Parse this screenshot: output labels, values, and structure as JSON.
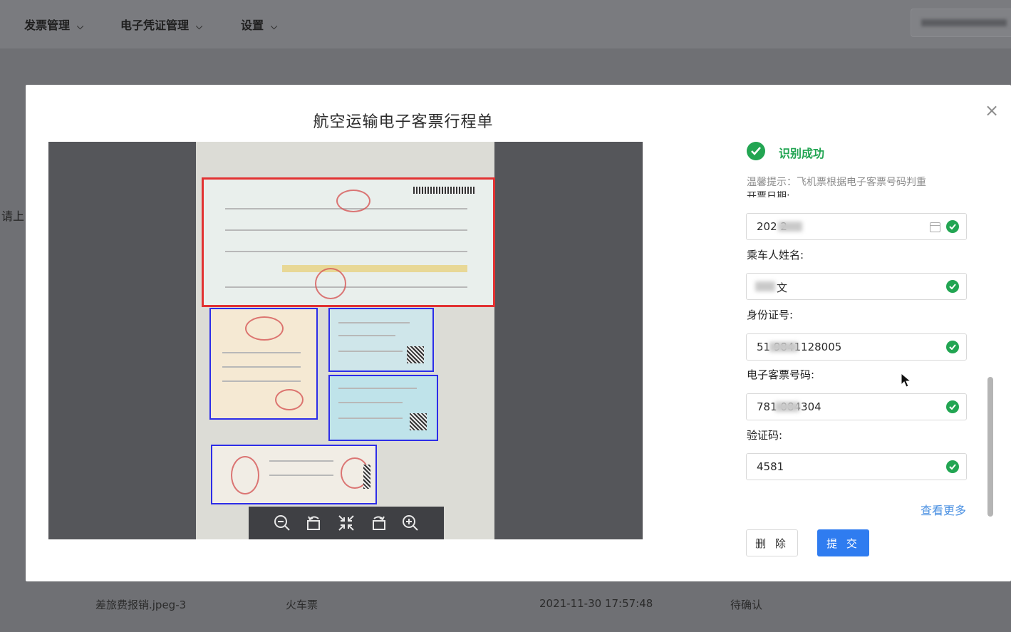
{
  "nav": {
    "items": [
      {
        "label": "发票管理"
      },
      {
        "label": "电子凭证管理"
      },
      {
        "label": "设置"
      }
    ]
  },
  "background": {
    "side_text": "请上",
    "row": {
      "file": "差旅费报销.jpeg-3",
      "type": "火车票",
      "time": "2021-11-30 17:57:48",
      "status": "待确认"
    }
  },
  "modal": {
    "title": "航空运输电子客票行程单",
    "close": "×",
    "status_text": "识别成功",
    "hint": "温馨提示：飞机票根据电子客票号码判重",
    "cut_label": "开票日期:",
    "fields": [
      {
        "label": "",
        "value": "202   2"
      },
      {
        "label": "乘车人姓名:",
        "value": "文"
      },
      {
        "label": "身份证号:",
        "value": "51     9841128005"
      },
      {
        "label": "电子客票号码:",
        "value": "781      084304"
      },
      {
        "label": "验证码:",
        "value": "4581"
      }
    ],
    "more_link": "查看更多",
    "delete_button": "删 除",
    "submit_button": "提 交"
  },
  "colors": {
    "success": "#22a552",
    "primary": "#2f7cf0",
    "highlight_red": "#e23232",
    "highlight_blue": "#2d2de8"
  },
  "icons": [
    "zoom-out-icon",
    "rotate-left-icon",
    "fit-screen-icon",
    "rotate-right-icon",
    "zoom-in-icon"
  ]
}
